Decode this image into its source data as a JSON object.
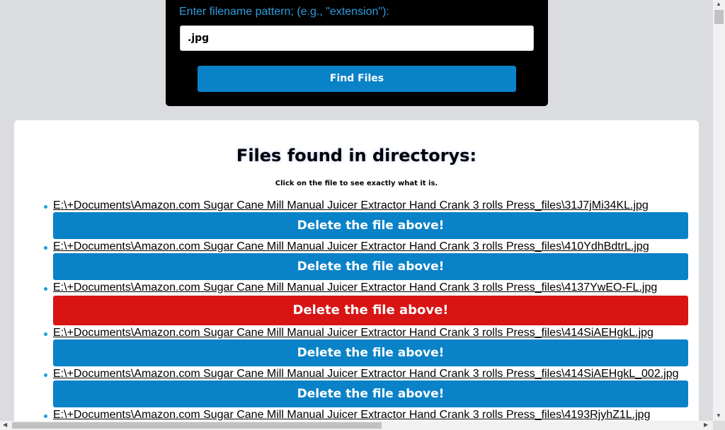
{
  "search": {
    "label": "Enter filename pattern; (e.g., \"extension\"):",
    "value": ".jpg",
    "button_label": "Find Files"
  },
  "results": {
    "title": "Files found in directorys:",
    "hint": "Click on the file to see exactly what it is.",
    "delete_label": "Delete the file above!",
    "files": [
      "E:\\+Documents\\Amazon.com Sugar Cane Mill Manual Juicer Extractor Hand Crank 3 rolls Press_files\\31J7jMi34KL.jpg",
      "E:\\+Documents\\Amazon.com Sugar Cane Mill Manual Juicer Extractor Hand Crank 3 rolls Press_files\\410YdhBdtrL.jpg",
      "E:\\+Documents\\Amazon.com Sugar Cane Mill Manual Juicer Extractor Hand Crank 3 rolls Press_files\\4137YwEO-FL.jpg",
      "E:\\+Documents\\Amazon.com Sugar Cane Mill Manual Juicer Extractor Hand Crank 3 rolls Press_files\\414SiAEHgkL.jpg",
      "E:\\+Documents\\Amazon.com Sugar Cane Mill Manual Juicer Extractor Hand Crank 3 rolls Press_files\\414SiAEHgkL_002.jpg",
      "E:\\+Documents\\Amazon.com Sugar Cane Mill Manual Juicer Extractor Hand Crank 3 rolls Press_files\\4193RjyhZ1L.jpg"
    ],
    "highlighted_index": 2
  },
  "colors": {
    "accent": "#0a82c8",
    "danger": "#d81414",
    "label": "#2d9cdb",
    "page_bg": "#dadce0"
  },
  "icons": {
    "scroll_up": "scroll-up-arrow-icon",
    "scroll_down": "scroll-down-arrow-icon",
    "scroll_left": "scroll-left-arrow-icon",
    "scroll_right": "scroll-right-arrow-icon"
  }
}
